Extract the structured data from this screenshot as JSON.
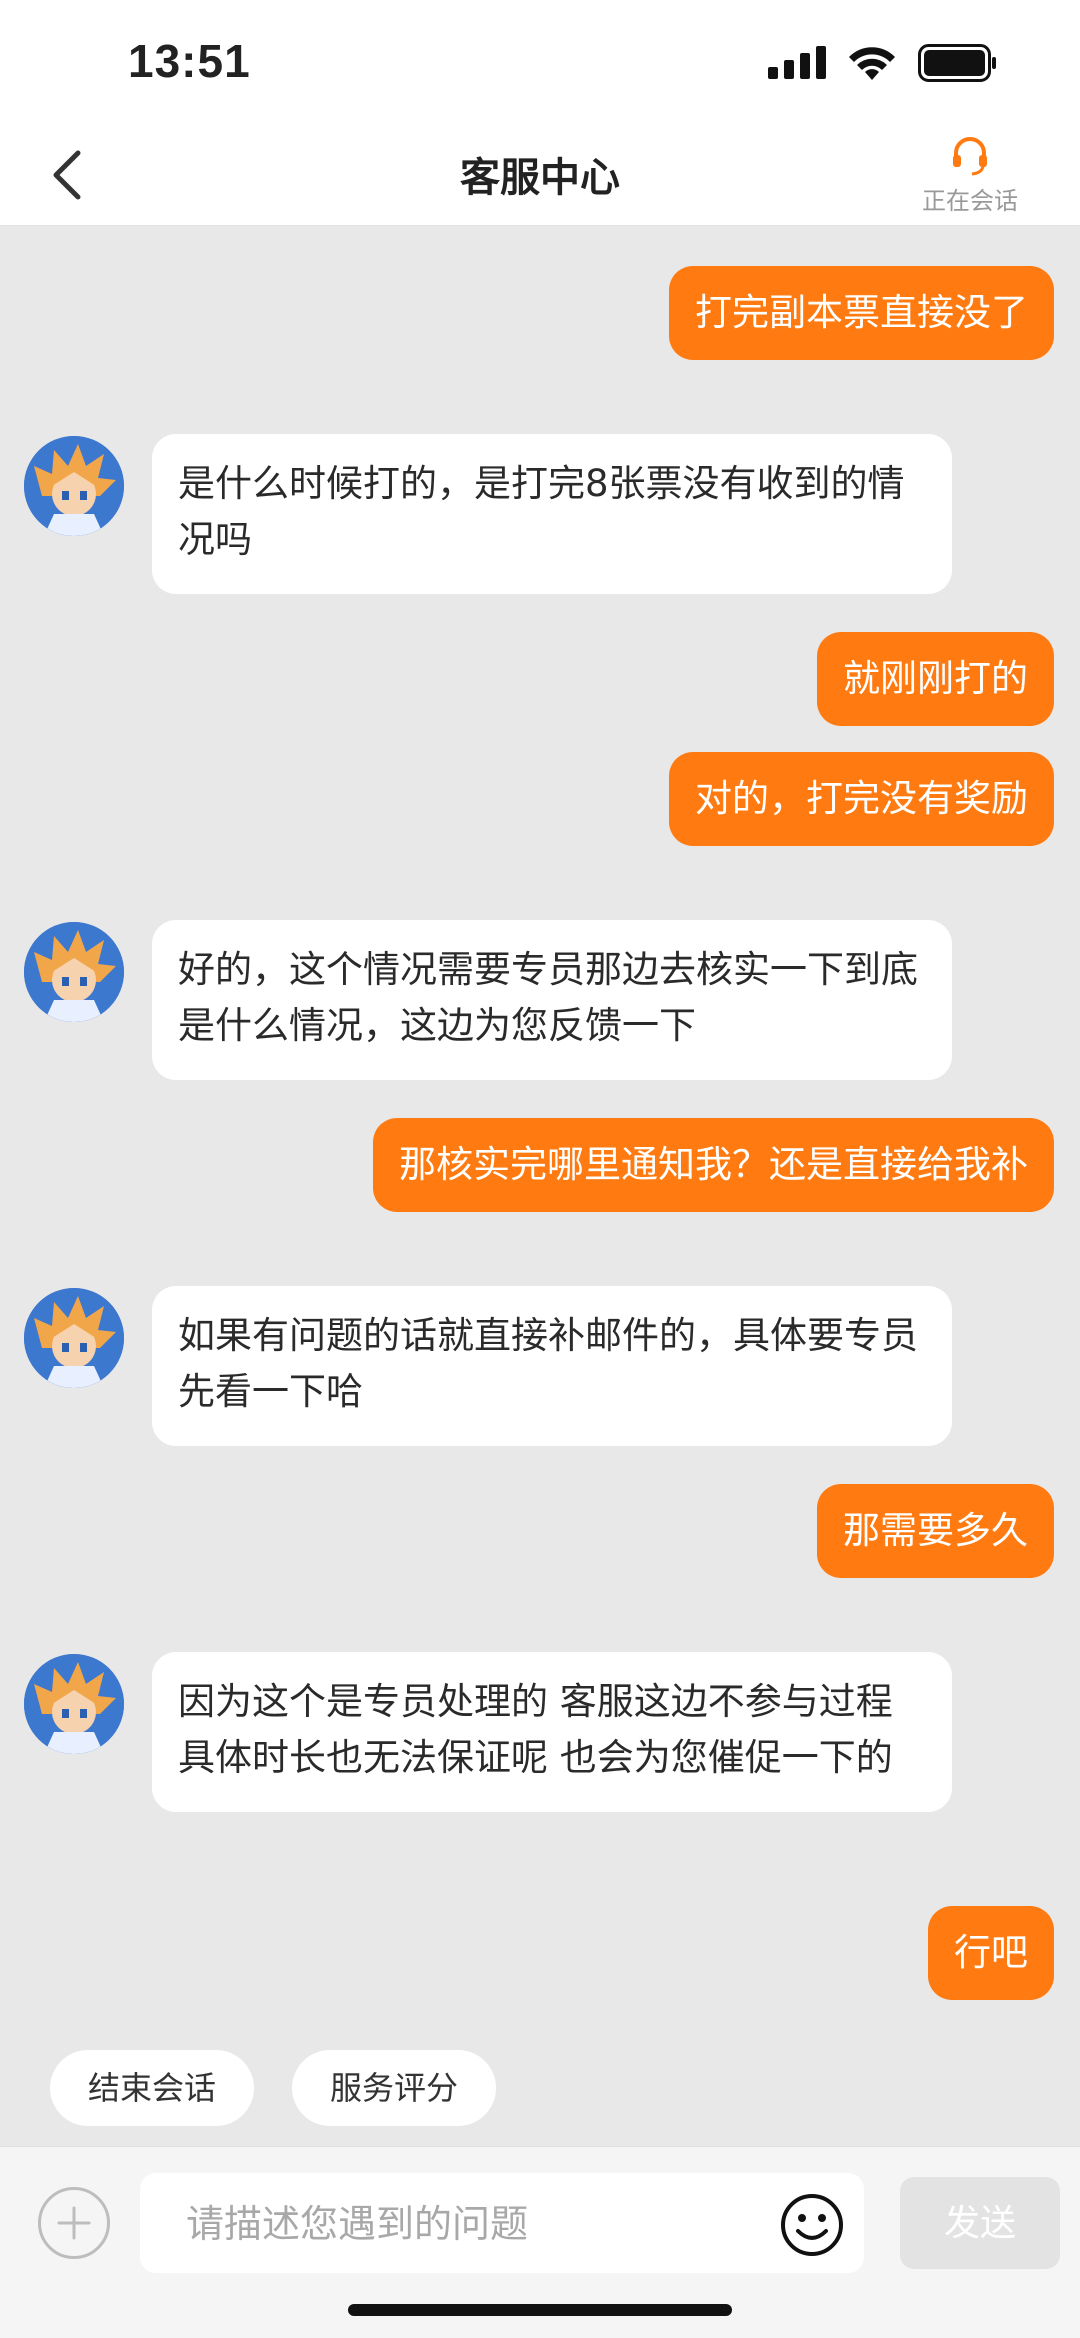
{
  "status_bar": {
    "time": "13:51"
  },
  "header": {
    "title": "客服中心",
    "session_label": "正在会话"
  },
  "messages": [
    {
      "from": "user",
      "text": "打完副本票直接没了"
    },
    {
      "from": "agent",
      "text": "是什么时候打的，是打完8张票没有收到的情况吗"
    },
    {
      "from": "user",
      "text": "就刚刚打的"
    },
    {
      "from": "user",
      "text": "对的，打完没有奖励"
    },
    {
      "from": "agent",
      "text": "好的，这个情况需要专员那边去核实一下到底是什么情况，这边为您反馈一下"
    },
    {
      "from": "user",
      "text": "那核实完哪里通知我？还是直接给我补"
    },
    {
      "from": "agent",
      "text": "如果有问题的话就直接补邮件的，具体要专员先看一下哈"
    },
    {
      "from": "user",
      "text": "那需要多久"
    },
    {
      "from": "agent",
      "text": "因为这个是专员处理的 客服这边不参与过程 具体时长也无法保证呢 也会为您催促一下的"
    },
    {
      "from": "user",
      "text": "行吧"
    }
  ],
  "quick_actions": {
    "end_session": "结束会话",
    "rate_service": "服务评分"
  },
  "composer": {
    "placeholder": "请描述您遇到的问题",
    "send_label": "发送"
  },
  "colors": {
    "accent": "#ff7b12",
    "background": "#e8e8e8",
    "send_disabled": "#e3e3e3"
  },
  "icons": {
    "back": "chevron-left-icon",
    "headset": "headset-icon",
    "plus": "plus-icon",
    "emoji": "smiley-icon"
  }
}
